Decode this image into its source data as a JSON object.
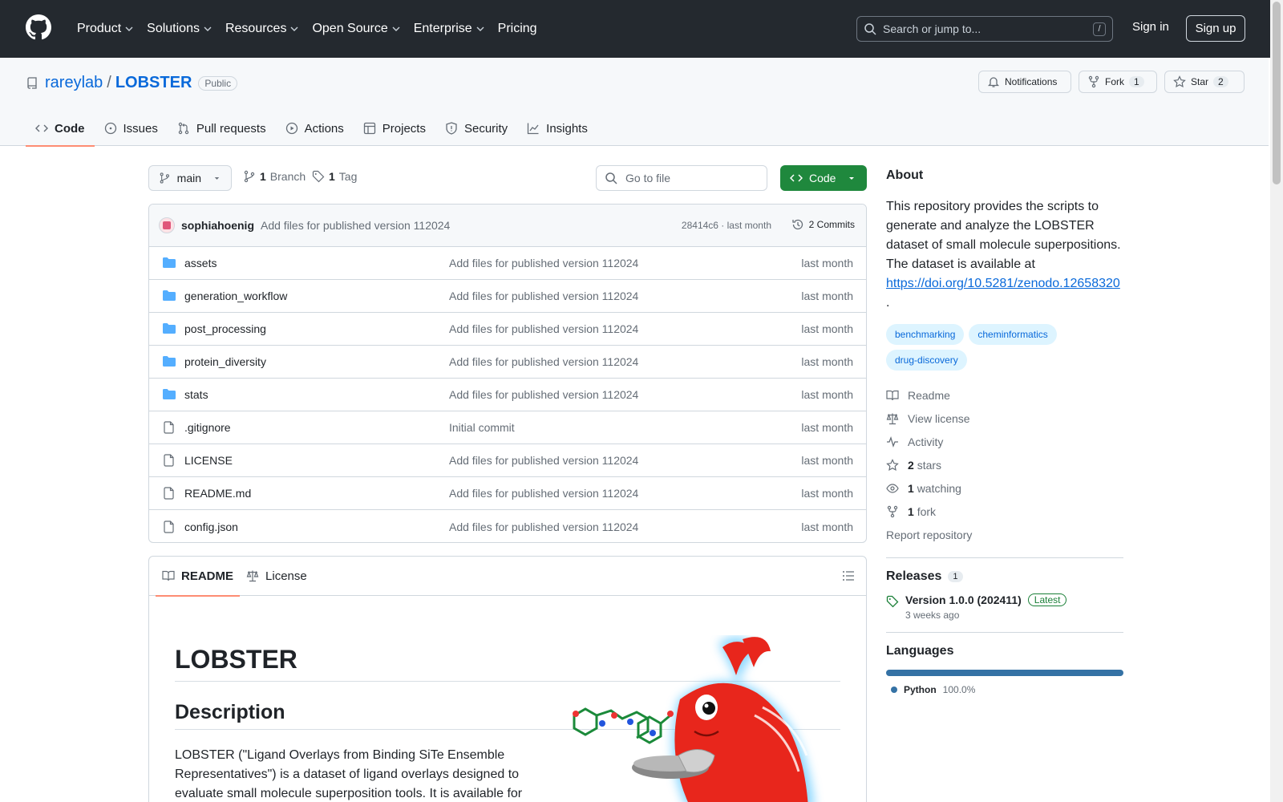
{
  "topnav": {
    "items": [
      "Product",
      "Solutions",
      "Resources",
      "Open Source",
      "Enterprise",
      "Pricing"
    ],
    "search_placeholder": "Search or jump to...",
    "search_shortcut": "/",
    "signin": "Sign in",
    "signup": "Sign up"
  },
  "repo": {
    "owner": "rareylab",
    "name": "LOBSTER",
    "visibility": "Public",
    "notifications": "Notifications",
    "fork_label": "Fork",
    "fork_count": "1",
    "star_label": "Star",
    "star_count": "2"
  },
  "tabs": [
    "Code",
    "Issues",
    "Pull requests",
    "Actions",
    "Projects",
    "Security",
    "Insights"
  ],
  "toolbar": {
    "branch": "main",
    "branches_count": "1",
    "branches_label": "Branch",
    "tags_count": "1",
    "tags_label": "Tag",
    "goto_file": "Go to file",
    "code_button": "Code"
  },
  "commit": {
    "author": "sophiahoenig",
    "message": "Add files for published version 112024",
    "sha_time": "28414c6 · last month",
    "count": "2 Commits"
  },
  "files": [
    {
      "name": "assets",
      "type": "dir",
      "message": "Add files for published version 112024",
      "date": "last month"
    },
    {
      "name": "generation_workflow",
      "type": "dir",
      "message": "Add files for published version 112024",
      "date": "last month"
    },
    {
      "name": "post_processing",
      "type": "dir",
      "message": "Add files for published version 112024",
      "date": "last month"
    },
    {
      "name": "protein_diversity",
      "type": "dir",
      "message": "Add files for published version 112024",
      "date": "last month"
    },
    {
      "name": "stats",
      "type": "dir",
      "message": "Add files for published version 112024",
      "date": "last month"
    },
    {
      "name": ".gitignore",
      "type": "file",
      "message": "Initial commit",
      "date": "last month"
    },
    {
      "name": "LICENSE",
      "type": "file",
      "message": "Add files for published version 112024",
      "date": "last month"
    },
    {
      "name": "README.md",
      "type": "file",
      "message": "Add files for published version 112024",
      "date": "last month"
    },
    {
      "name": "config.json",
      "type": "file",
      "message": "Add files for published version 112024",
      "date": "last month"
    }
  ],
  "readme": {
    "tab_readme": "README",
    "tab_license": "License",
    "h1": "LOBSTER",
    "h2": "Description",
    "paragraph": "LOBSTER (\"Ligand Overlays from Binding SiTe Ensemble Representatives\") is a dataset of ligand overlays designed to evaluate small molecule superposition tools. It is available for"
  },
  "about": {
    "title": "About",
    "description": "This repository provides the scripts to generate and analyze the LOBSTER dataset of small molecule superpositions. The dataset is available at",
    "link": "https://doi.org/10.5281/zenodo.12658320",
    "after_link": ".",
    "topics": [
      "benchmarking",
      "cheminformatics",
      "drug-discovery"
    ],
    "readme": "Readme",
    "license": "View license",
    "activity": "Activity",
    "stars_count": "2",
    "stars_label": "stars",
    "watching_count": "1",
    "watching_label": "watching",
    "fork_count": "1",
    "fork_label": "fork",
    "report": "Report repository"
  },
  "releases": {
    "title": "Releases",
    "count": "1",
    "name": "Version 1.0.0 (202411)",
    "badge": "Latest",
    "date": "3 weeks ago"
  },
  "languages": {
    "title": "Languages",
    "items": [
      {
        "name": "Python",
        "percent": "100.0%",
        "color": "#3572A5"
      }
    ]
  }
}
